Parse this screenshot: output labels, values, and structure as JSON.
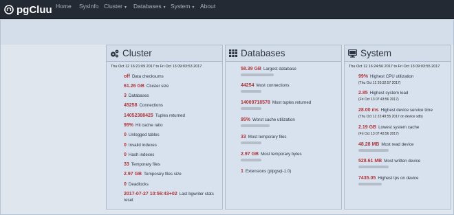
{
  "nav": {
    "brand": "pgCluu",
    "items": [
      "Home",
      "SysInfo",
      "Cluster",
      "Databases",
      "System",
      "About"
    ],
    "caret": "▾"
  },
  "cluster": {
    "title": "Cluster",
    "range": "Thu Oct 12 16:21:09 2017 to Fri Oct 13 09:03:53 2017",
    "stats": [
      {
        "value": "off",
        "label": "Data checksums"
      },
      {
        "value": "61.26 GB",
        "label": "Cluster size"
      },
      {
        "value": "3",
        "label": "Databases"
      },
      {
        "value": "45258",
        "label": "Connections"
      },
      {
        "value": "14052388425",
        "label": "Tuples returned"
      },
      {
        "value": "95%",
        "label": "Hit cache ratio"
      },
      {
        "value": "0",
        "label": "Unlogged tables"
      },
      {
        "value": "0",
        "label": "Invalid indexes"
      },
      {
        "value": "0",
        "label": "Hash indexes"
      },
      {
        "value": "33",
        "label": "Temporary files"
      },
      {
        "value": "2.97 GB",
        "label": "Temporary files size"
      },
      {
        "value": "0",
        "label": "Deadlocks"
      },
      {
        "value": "2017-07-27 10:56:43+02",
        "label": "Last bgwriter stats",
        "label2": "reset"
      }
    ]
  },
  "databases": {
    "title": "Databases",
    "stats": [
      {
        "value": "58.39 GB",
        "label": "Largest database"
      },
      {
        "value": "44254",
        "label": "Most connections"
      },
      {
        "value": "14009718578",
        "label": "Most tuples returned"
      },
      {
        "value": "95%",
        "label": "Worst cache utilization"
      },
      {
        "value": "33",
        "label": "Most temporary files"
      },
      {
        "value": "2.97 GB",
        "label": "Most temporary bytes"
      },
      {
        "value": "1",
        "label": "Extensions (plpgsql-1.0)"
      }
    ]
  },
  "system": {
    "title": "System",
    "range": "Thu Oct 12 16:24:56 2017 to Fri Oct 13 09:03:55 2017",
    "stats": [
      {
        "value": "99%",
        "label": "Highest CPU utilization",
        "sub": "(Thu Oct 12 20:32:57 2017)"
      },
      {
        "value": "2.85",
        "label": "Highest system load",
        "sub": "(Fri Oct 13 07:43:56 2017)"
      },
      {
        "value": "28.00 ms",
        "label": "Highest device service time",
        "sub": "(Thu Oct 12 22:49:55 2017 on device sdb)"
      },
      {
        "value": "2.19 GB",
        "label": "Lowest system cache",
        "sub": "(Fri Oct 13 07:43:56 2017)"
      },
      {
        "value": "48.28 MB",
        "label": "Most read device"
      },
      {
        "value": "528.61 MB",
        "label": "Most written device"
      },
      {
        "value": "7435.05",
        "label": "Highest tps on device"
      }
    ]
  },
  "colors": {
    "value": "#b0353a",
    "navbar": "#232a34",
    "panel": "#d8e2ee"
  }
}
